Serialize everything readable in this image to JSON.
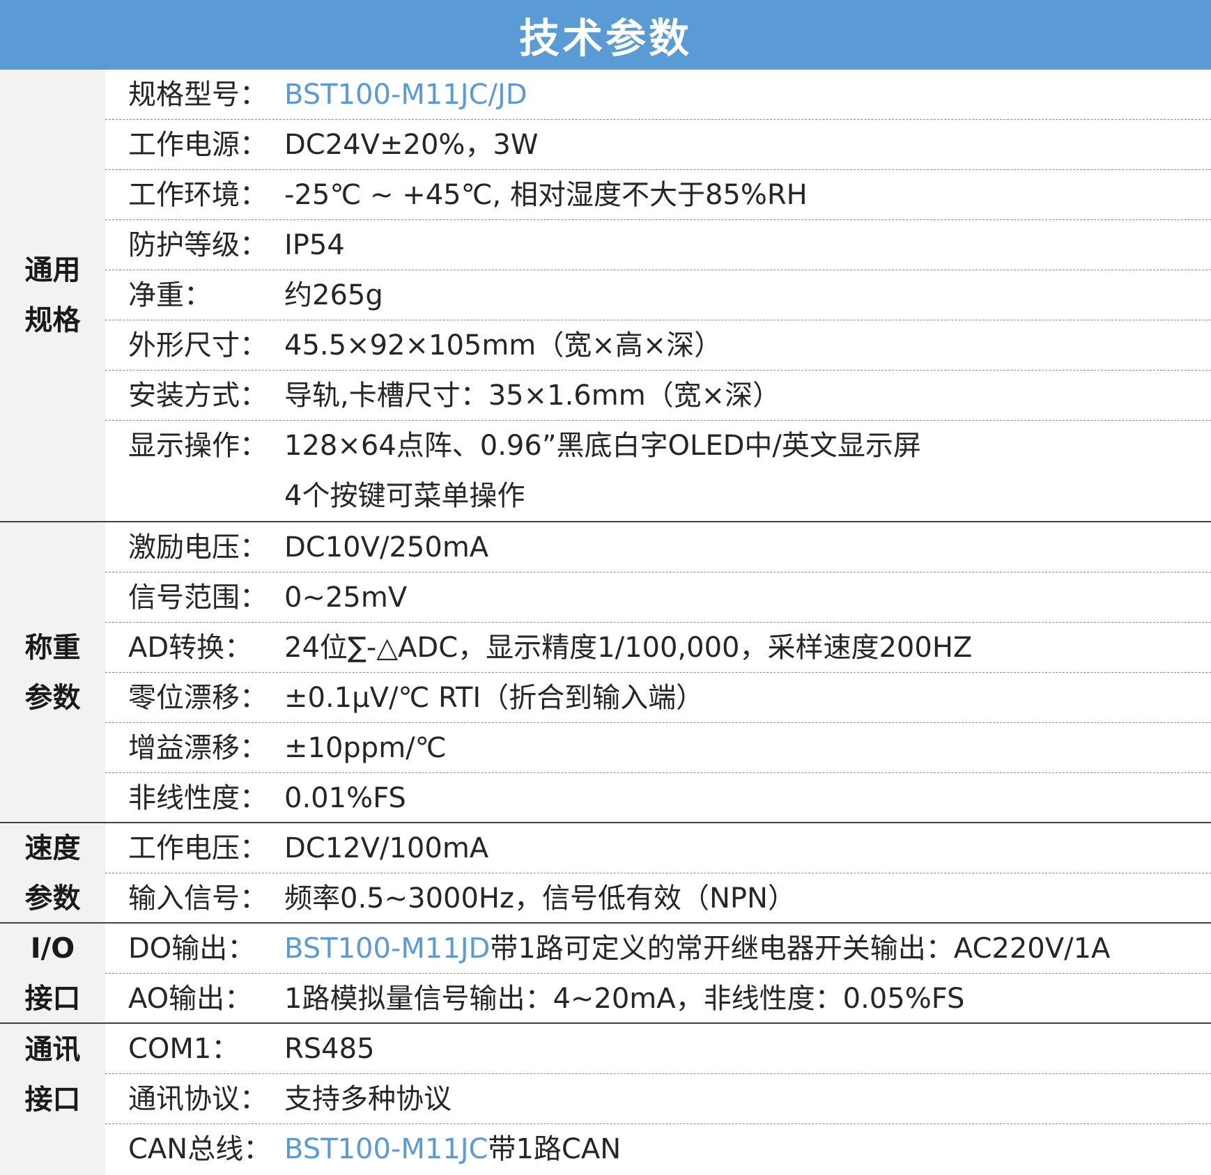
{
  "title": "技术参数",
  "colors": {
    "header_bg": "#5b9bd5",
    "accent_text": "#5b9bd5",
    "label_bg": "#f2f2f2"
  },
  "sections": [
    {
      "label": "通用规格",
      "label_lines": [
        "通用",
        "规格"
      ],
      "rows": [
        {
          "label": "规格型号：",
          "accent": "BST100-M11JC/JD",
          "value": ""
        },
        {
          "label": "工作电源：",
          "value": "DC24V±20%，3W"
        },
        {
          "label": "工作环境：",
          "value": "-25℃ ~ +45℃, 相对湿度不大于85%RH"
        },
        {
          "label": "防护等级：",
          "value": "IP54"
        },
        {
          "label": "净重：",
          "value": "约265g"
        },
        {
          "label": "外形尺寸：",
          "value": "45.5×92×105mm（宽×高×深）"
        },
        {
          "label": "安装方式：",
          "value": "导轨,卡槽尺寸：35×1.6mm（宽×深）"
        },
        {
          "label": "显示操作：",
          "value": "128×64点阵、0.96”黑底白字OLED中/英文显示屏",
          "value2": "4个按键可菜单操作"
        }
      ]
    },
    {
      "label": "称重参数",
      "label_lines": [
        "称重",
        "参数"
      ],
      "rows": [
        {
          "label": "激励电压：",
          "value": "DC10V/250mA"
        },
        {
          "label": "信号范围：",
          "value": "0~25mV"
        },
        {
          "label": "AD转换：",
          "value": "24位∑-△ADC，显示精度1/100,000，采样速度200HZ"
        },
        {
          "label": "零位漂移：",
          "value": "±0.1μV/℃ RTI（折合到输入端）"
        },
        {
          "label": "增益漂移：",
          "value": "±10ppm/℃"
        },
        {
          "label": "非线性度：",
          "value": "0.01%FS"
        }
      ]
    },
    {
      "label": "速度参数",
      "label_lines": [
        "速度",
        "参数"
      ],
      "rows": [
        {
          "label": "工作电压：",
          "value": "DC12V/100mA"
        },
        {
          "label": "输入信号：",
          "value": "频率0.5~3000Hz，信号低有效（NPN）"
        }
      ]
    },
    {
      "label": "I/O接口",
      "label_lines": [
        "I/O",
        "接口"
      ],
      "rows": [
        {
          "label": "DO输出：",
          "accent": "BST100-M11JD",
          "value": "带1路可定义的常开继电器开关输出：AC220V/1A"
        },
        {
          "label": "AO输出：",
          "value": "1路模拟量信号输出：4~20mA，非线性度：0.05%FS"
        }
      ]
    },
    {
      "label": "通讯接口",
      "label_lines": [
        "通讯",
        "接口"
      ],
      "rows": [
        {
          "label": "COM1：",
          "value": "RS485"
        },
        {
          "label": "通讯协议：",
          "value": "支持多种协议"
        },
        {
          "label": "CAN总线：",
          "accent": "BST100-M11JC",
          "value": "带1路CAN"
        }
      ]
    }
  ]
}
